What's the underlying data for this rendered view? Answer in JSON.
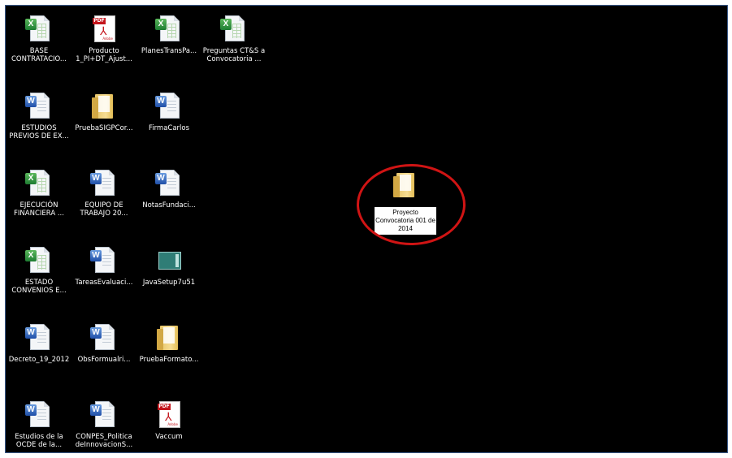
{
  "desktop": {
    "icons": [
      {
        "label": "BASE CONTRATACIO...",
        "type": "excel"
      },
      {
        "label": "Producto 1_PI+DT_Ajust...",
        "type": "pdf"
      },
      {
        "label": "PlanesTransPa...",
        "type": "excel"
      },
      {
        "label": "Preguntas CT&S a Convocatoria ...",
        "type": "excel"
      },
      {
        "label": "ESTUDIOS PREVIOS DE EX...",
        "type": "word"
      },
      {
        "label": "PruebaSIGPCor...",
        "type": "folder"
      },
      {
        "label": "FirmaCarlos",
        "type": "word"
      },
      {
        "label": "EJECUCIÓN FINANCIERA ...",
        "type": "excel"
      },
      {
        "label": "EQUIPO DE TRABAJO 20...",
        "type": "word"
      },
      {
        "label": "NotasFundaci...",
        "type": "word"
      },
      {
        "label": "ESTADO CONVENIOS E...",
        "type": "excel"
      },
      {
        "label": "TareasEvaluaci...",
        "type": "word"
      },
      {
        "label": "JavaSetup7u51",
        "type": "installer"
      },
      {
        "label": "Decreto_19_2012",
        "type": "word"
      },
      {
        "label": "ObsFormualri...",
        "type": "word"
      },
      {
        "label": "PruebaFormato...",
        "type": "folder"
      },
      {
        "label": "Estudios de la OCDE de la...",
        "type": "word"
      },
      {
        "label": "CONPES_Politica deInnovacionS...",
        "type": "word"
      },
      {
        "label": "Vaccum",
        "type": "pdf"
      }
    ],
    "selected_folder": {
      "label": "Proyecto Convocatoria 001 de 2014",
      "type": "folder"
    },
    "highlight_color": "#d01414",
    "background_color": "#000000"
  }
}
